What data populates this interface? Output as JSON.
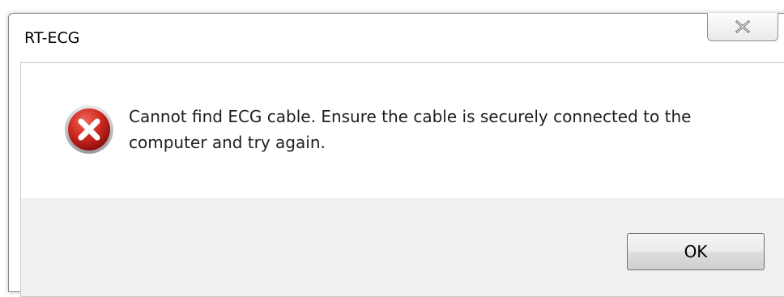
{
  "window": {
    "title": "RT-ECG"
  },
  "title_bar": {
    "close_icon": "close-icon"
  },
  "dialog": {
    "icon": "error-icon",
    "message": "Cannot find ECG cable. Ensure the cable is securely connected to the computer and try again."
  },
  "buttons": {
    "ok_label": "OK"
  },
  "colors": {
    "error_red": "#c8201f",
    "footer_bg": "#f0f0f0"
  }
}
